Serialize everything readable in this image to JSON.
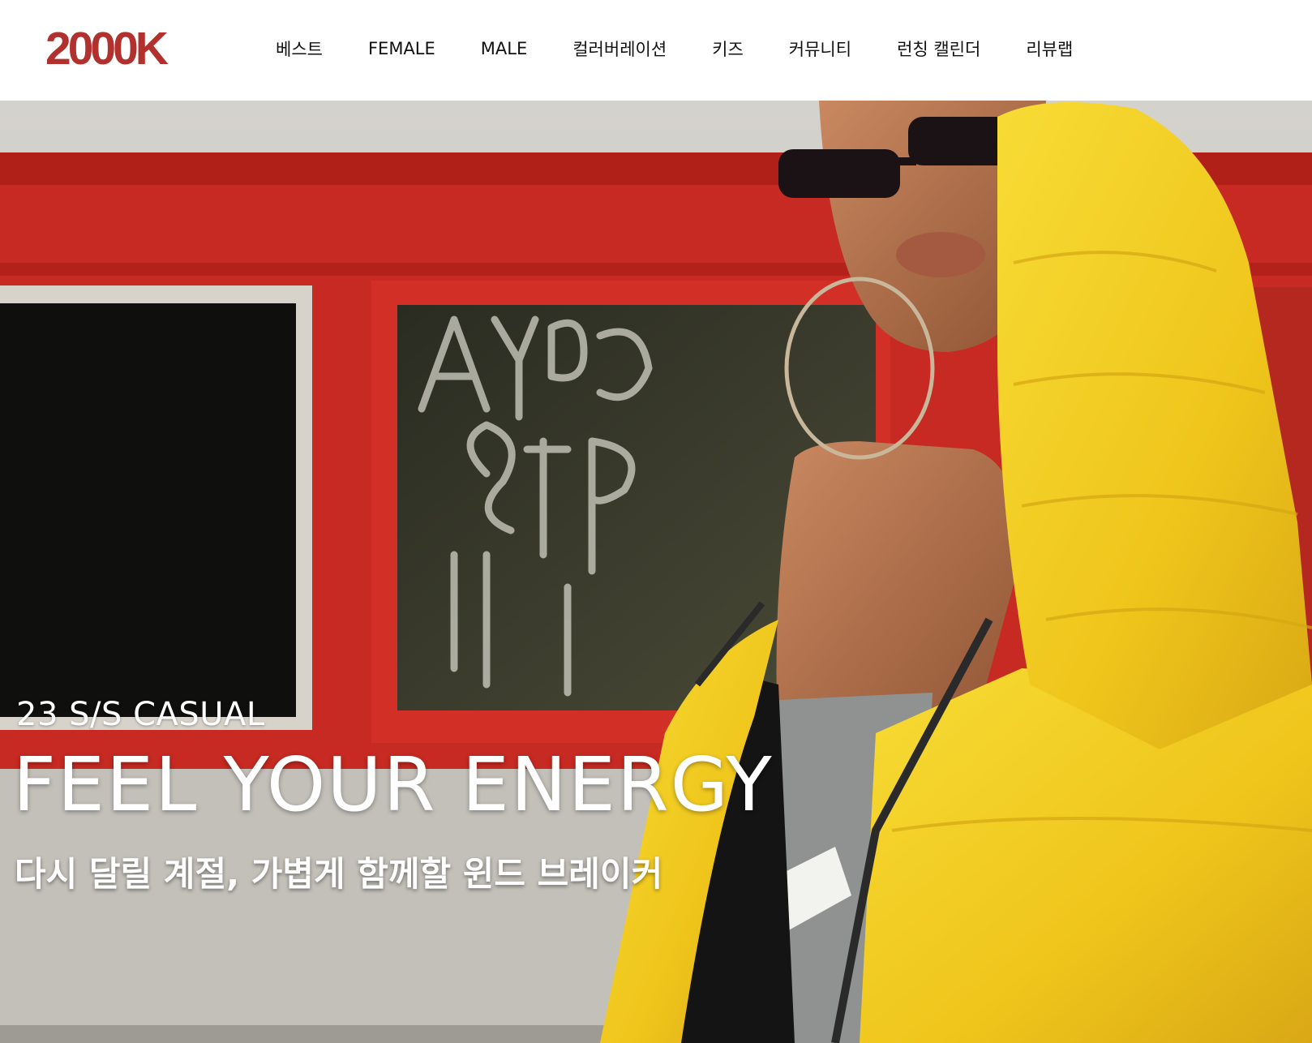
{
  "brand": {
    "logo_text": "2000K",
    "logo_color": "#b0312e"
  },
  "nav": {
    "items": [
      {
        "label": "베스트"
      },
      {
        "label": "FEMALE"
      },
      {
        "label": "MALE"
      },
      {
        "label": "컬러버레이션"
      },
      {
        "label": "키즈"
      },
      {
        "label": "커뮤니티"
      },
      {
        "label": "런칭 캘린더"
      },
      {
        "label": "리뷰랩"
      }
    ]
  },
  "hero": {
    "season": "23 S/S CASUAL",
    "title": "FEEL YOUR ENERGY",
    "subtitle": "다시 달릴 계절, 가볍게 함께할 윈드 브레이커",
    "colors": {
      "wall": "#c8c6c0",
      "frame_red": "#c62a22",
      "jacket_yellow": "#f2cf1f"
    }
  }
}
